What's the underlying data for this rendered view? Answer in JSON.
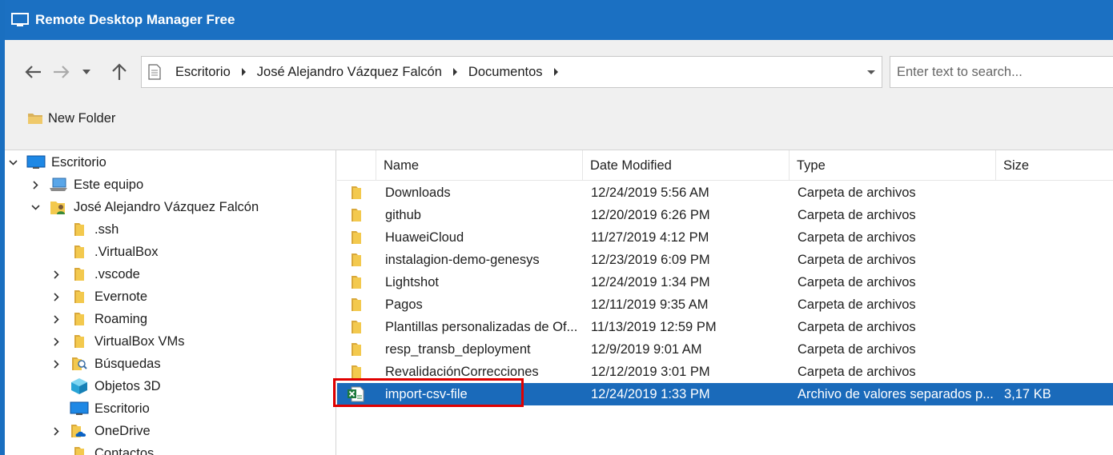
{
  "window": {
    "title": "Remote Desktop Manager Free"
  },
  "nav": {
    "breadcrumbs": [
      "Escritorio",
      "José Alejandro Vázquez Falcón",
      "Documentos"
    ]
  },
  "search": {
    "placeholder": "Enter text to search..."
  },
  "toolbar": {
    "new_folder_label": "New Folder"
  },
  "tree": {
    "items": [
      {
        "label": "Escritorio",
        "icon": "desktop-icon",
        "expander": "expanded"
      },
      {
        "label": "Este equipo",
        "icon": "computer-icon",
        "expander": "collapsed"
      },
      {
        "label": "José Alejandro Vázquez Falcón",
        "icon": "user-folder-icon",
        "expander": "expanded"
      },
      {
        "label": ".ssh",
        "icon": "folder-icon",
        "expander": "none"
      },
      {
        "label": ".VirtualBox",
        "icon": "folder-icon",
        "expander": "none"
      },
      {
        "label": ".vscode",
        "icon": "folder-icon",
        "expander": "collapsed"
      },
      {
        "label": "Evernote",
        "icon": "folder-icon",
        "expander": "collapsed"
      },
      {
        "label": "Roaming",
        "icon": "folder-icon",
        "expander": "collapsed"
      },
      {
        "label": "VirtualBox VMs",
        "icon": "folder-icon",
        "expander": "collapsed"
      },
      {
        "label": "Búsquedas",
        "icon": "search-folder-icon",
        "expander": "collapsed"
      },
      {
        "label": "Objetos 3D",
        "icon": "3d-objects-icon",
        "expander": "none"
      },
      {
        "label": "Escritorio",
        "icon": "desktop-icon",
        "expander": "none"
      },
      {
        "label": "OneDrive",
        "icon": "onedrive-icon",
        "expander": "collapsed"
      },
      {
        "label": "Contactos",
        "icon": "folder-icon",
        "expander": "none"
      }
    ]
  },
  "list": {
    "columns": [
      "Name",
      "Date Modified",
      "Type",
      "Size"
    ],
    "rows": [
      {
        "name": "Downloads",
        "date": "12/24/2019 5:56 AM",
        "type": "Carpeta de archivos",
        "size": "",
        "icon": "folder-icon"
      },
      {
        "name": "github",
        "date": "12/20/2019 6:26 PM",
        "type": "Carpeta de archivos",
        "size": "",
        "icon": "folder-icon"
      },
      {
        "name": "HuaweiCloud",
        "date": "11/27/2019 4:12 PM",
        "type": "Carpeta de archivos",
        "size": "",
        "icon": "folder-icon"
      },
      {
        "name": "instalagion-demo-genesys",
        "date": "12/23/2019 6:09 PM",
        "type": "Carpeta de archivos",
        "size": "",
        "icon": "folder-icon"
      },
      {
        "name": "Lightshot",
        "date": "12/24/2019 1:34 PM",
        "type": "Carpeta de archivos",
        "size": "",
        "icon": "folder-icon"
      },
      {
        "name": "Pagos",
        "date": "12/11/2019 9:35 AM",
        "type": "Carpeta de archivos",
        "size": "",
        "icon": "folder-icon"
      },
      {
        "name": "Plantillas personalizadas de Of...",
        "date": "11/13/2019 12:59 PM",
        "type": "Carpeta de archivos",
        "size": "",
        "icon": "folder-icon"
      },
      {
        "name": "resp_transb_deployment",
        "date": "12/9/2019 9:01 AM",
        "type": "Carpeta de archivos",
        "size": "",
        "icon": "folder-icon"
      },
      {
        "name": "RevalidaciónCorrecciones",
        "date": "12/12/2019 3:01 PM",
        "type": "Carpeta de archivos",
        "size": "",
        "icon": "folder-icon"
      },
      {
        "name": "import-csv-file",
        "date": "12/24/2019 1:33 PM",
        "type": "Archivo de valores separados p...",
        "size": "3,17 KB",
        "icon": "excel-csv-icon",
        "selected": true
      }
    ]
  },
  "colors": {
    "titlebar": "#1b70c2",
    "selection": "#1a6aba",
    "highlight_border": "#e00000"
  }
}
